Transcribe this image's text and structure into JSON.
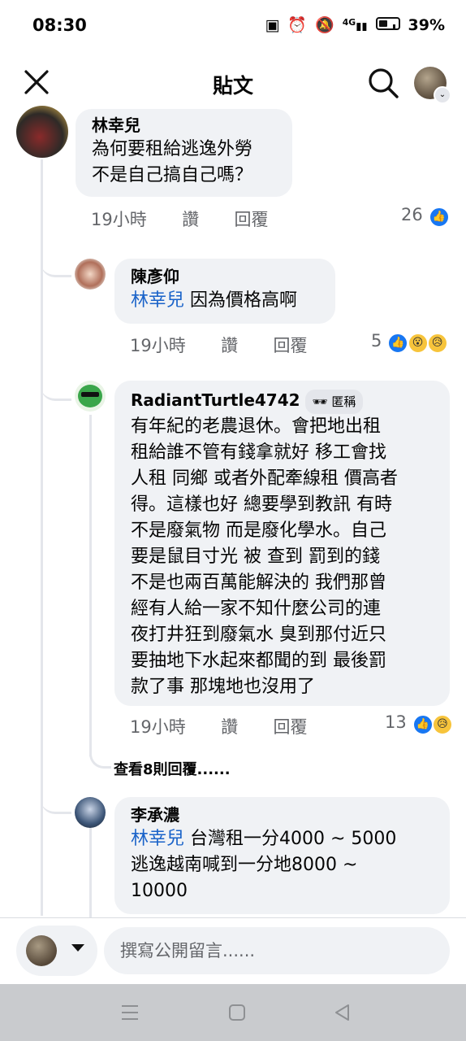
{
  "status_bar": {
    "time": "08:30",
    "signal_label": "4G",
    "battery_percent": "39%"
  },
  "header": {
    "title": "貼文"
  },
  "comments": [
    {
      "author": "林幸兒",
      "text": "為何要租給逃逸外勞\n不是自己搞自己嗎？",
      "time": "19小時",
      "like_label": "讚",
      "reply_label": "回覆",
      "reaction_count": "26"
    },
    {
      "author": "陳彥仰",
      "mention": "林幸兒",
      "text": " 因為價格高啊",
      "time": "19小時",
      "like_label": "讚",
      "reply_label": "回覆",
      "reaction_count": "5"
    },
    {
      "author": "RadiantTurtle4742",
      "badge": "匿稱",
      "text": "有年紀的老農退休。會把地出租\n租給誰不管有錢拿就好 移工會找\n人租 同鄉 或者外配牽線租 價高者\n得。這樣也好 總要學到教訊 有時\n不是廢氣物 而是廢化學水。自己\n要是鼠目寸光 被 查到 罰到的錢\n不是也兩百萬能解決的  我們那曾\n經有人給一家不知什麼公司的連\n夜打井狂到廢氣水 臭到那付近只\n要抽地下水起來都聞的到 最後罰\n款了事 那塊地也沒用了",
      "time": "19小時",
      "like_label": "讚",
      "reply_label": "回覆",
      "reaction_count": "13"
    },
    {
      "author": "李承濃",
      "mention": "林幸兒",
      "text": " 台灣租一分4000 ~ 5000\n逃逸越南喊到一分地8000 ~\n10000"
    }
  ],
  "view_more_replies": "查看8則回覆......",
  "composer": {
    "placeholder": "撰寫公開留言......"
  },
  "colors": {
    "accent": "#1877f2",
    "mention": "#1a63c9",
    "bubble": "#f0f2f5",
    "meta_text": "#65676b"
  }
}
